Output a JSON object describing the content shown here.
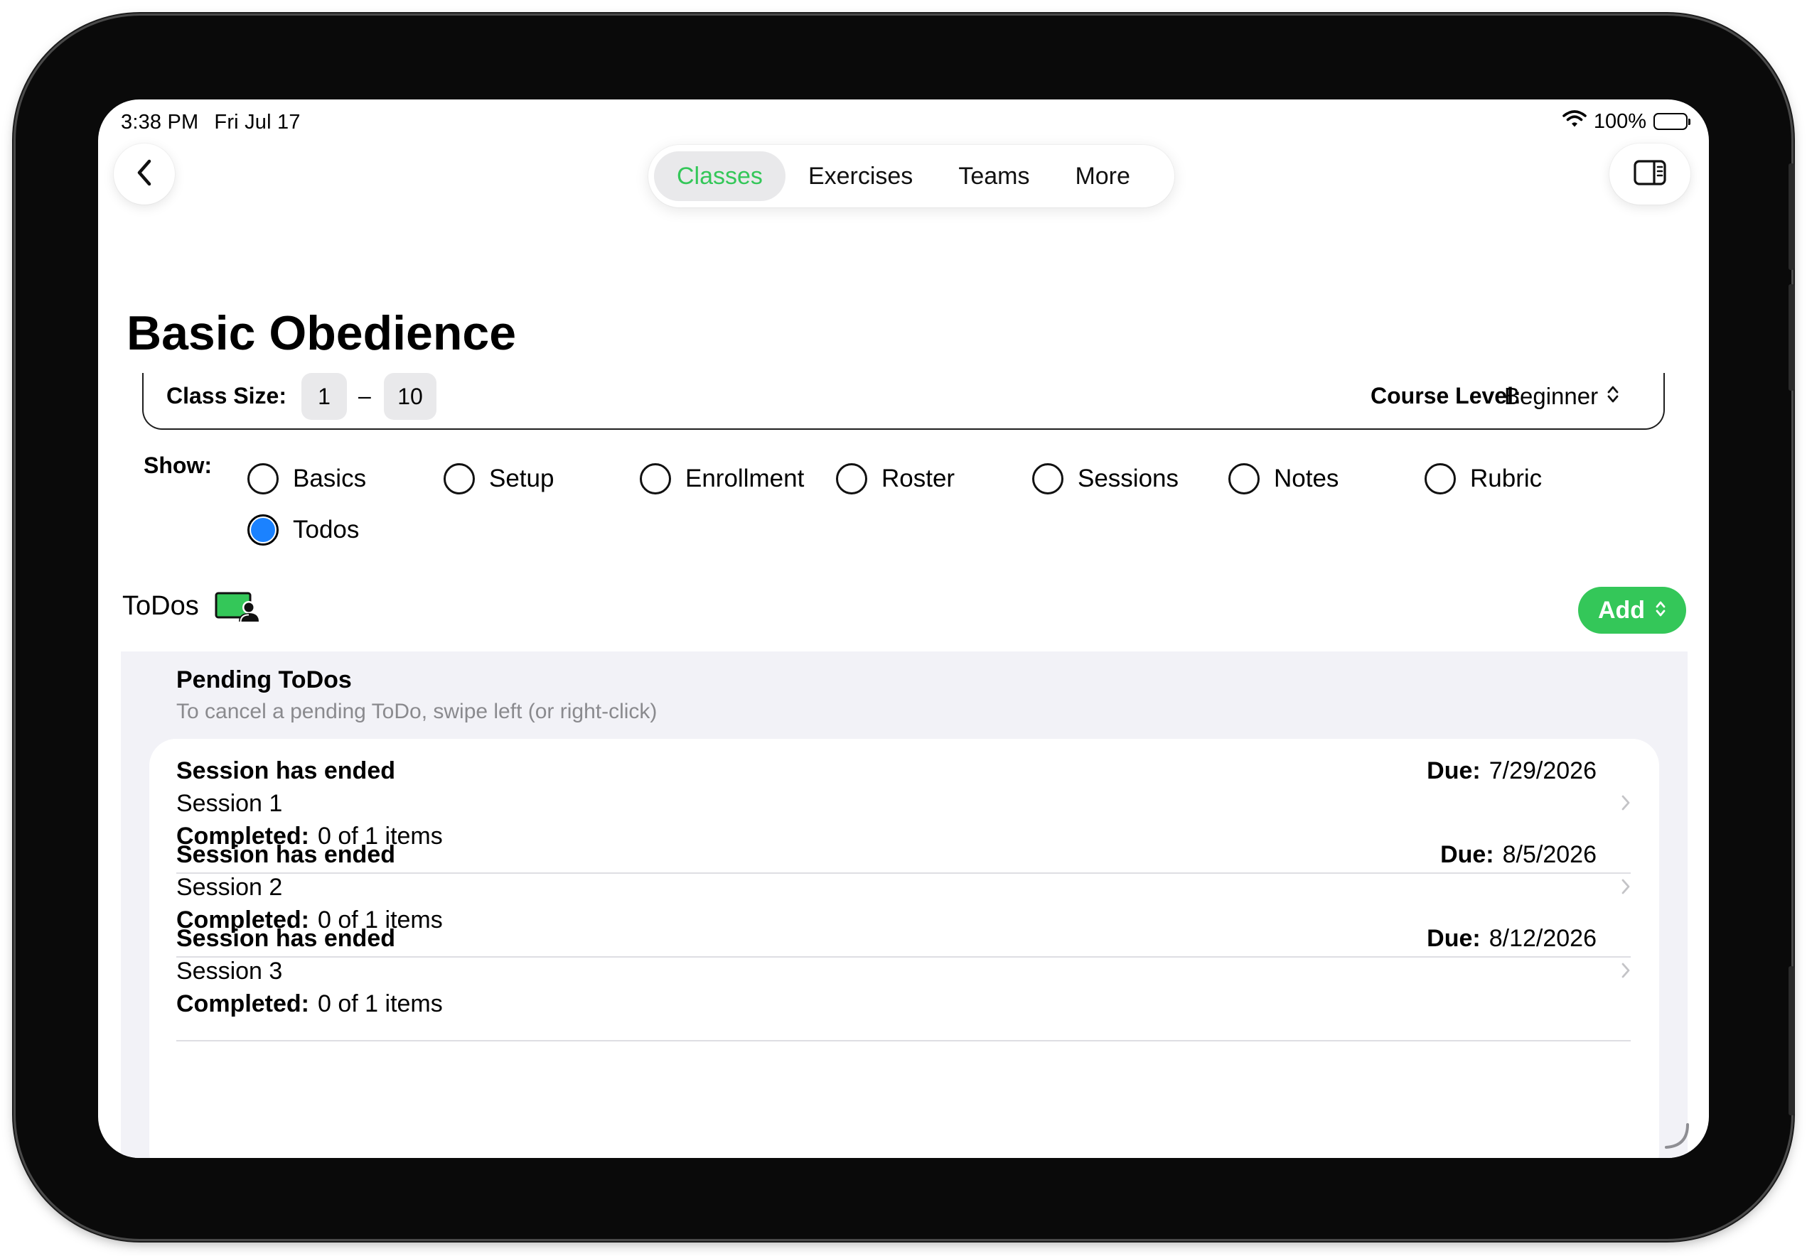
{
  "status_bar": {
    "time": "3:38 PM",
    "date": "Fri Jul 17",
    "battery": "100%"
  },
  "nav": {
    "back_icon": "chevron-left-icon",
    "sidebar_icon": "sidebar-toggle-icon",
    "tabs": [
      {
        "label": "Classes",
        "active": true
      },
      {
        "label": "Exercises",
        "active": false
      },
      {
        "label": "Teams",
        "active": false
      },
      {
        "label": "More",
        "active": false
      }
    ],
    "accent_color": "#34c759"
  },
  "page_title": "Basic Obedience",
  "class_size": {
    "label": "Class Size:",
    "min": "1",
    "separator": "–",
    "max": "10"
  },
  "course_level": {
    "label": "Course Level:",
    "value": "Beginner"
  },
  "show": {
    "label": "Show:",
    "options": [
      {
        "label": "Basics",
        "selected": false
      },
      {
        "label": "Setup",
        "selected": false
      },
      {
        "label": "Enrollment",
        "selected": false
      },
      {
        "label": "Roster",
        "selected": false
      },
      {
        "label": "Sessions",
        "selected": false
      },
      {
        "label": "Notes",
        "selected": false
      },
      {
        "label": "Rubric",
        "selected": false
      },
      {
        "label": "Todos",
        "selected": true
      }
    ],
    "selected_color": "#1b82ff"
  },
  "todos": {
    "heading": "ToDos",
    "icon": "monitor-person-icon",
    "add_label": "Add",
    "pending_title": "Pending ToDos",
    "pending_subtitle": "To cancel a pending ToDo, swipe left (or right-click)",
    "items": [
      {
        "title": "Session has ended",
        "session": "Session 1",
        "completed_label": "Completed:",
        "completed_value": "0 of 1 items",
        "due_label": "Due:",
        "due_value": "7/29/2026"
      },
      {
        "title": "Session has ended",
        "session": "Session 2",
        "completed_label": "Completed:",
        "completed_value": "0 of 1 items",
        "due_label": "Due:",
        "due_value": "8/5/2026"
      },
      {
        "title": "Session has ended",
        "session": "Session 3",
        "completed_label": "Completed:",
        "completed_value": "0 of 1 items",
        "due_label": "Due:",
        "due_value": "8/12/2026"
      }
    ]
  }
}
